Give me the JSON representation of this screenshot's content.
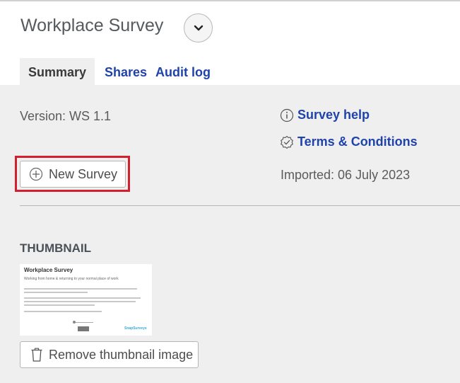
{
  "header": {
    "title": "Workplace Survey",
    "menu_icon": "chevron-down-icon",
    "tabs": [
      {
        "label": "Summary",
        "active": true
      },
      {
        "label": "Shares",
        "active": false
      },
      {
        "label": "Audit log",
        "active": false
      }
    ]
  },
  "summary": {
    "version": "Version: WS 1.1",
    "survey_help": "Survey help",
    "terms": "Terms & Conditions",
    "imported": "Imported: 06 July 2023",
    "new_survey_label": "New Survey"
  },
  "thumbnail_section": {
    "heading": "THUMBNAIL",
    "preview_title": "Workplace Survey",
    "preview_subtitle": "Working from home & returning to your normal place of work",
    "preview_logo_top": "",
    "preview_logo": "SnapSurveys",
    "remove_label": "Remove thumbnail image"
  },
  "colors": {
    "link": "#1f43a8",
    "highlight": "#d3202e",
    "background": "#efefef"
  }
}
